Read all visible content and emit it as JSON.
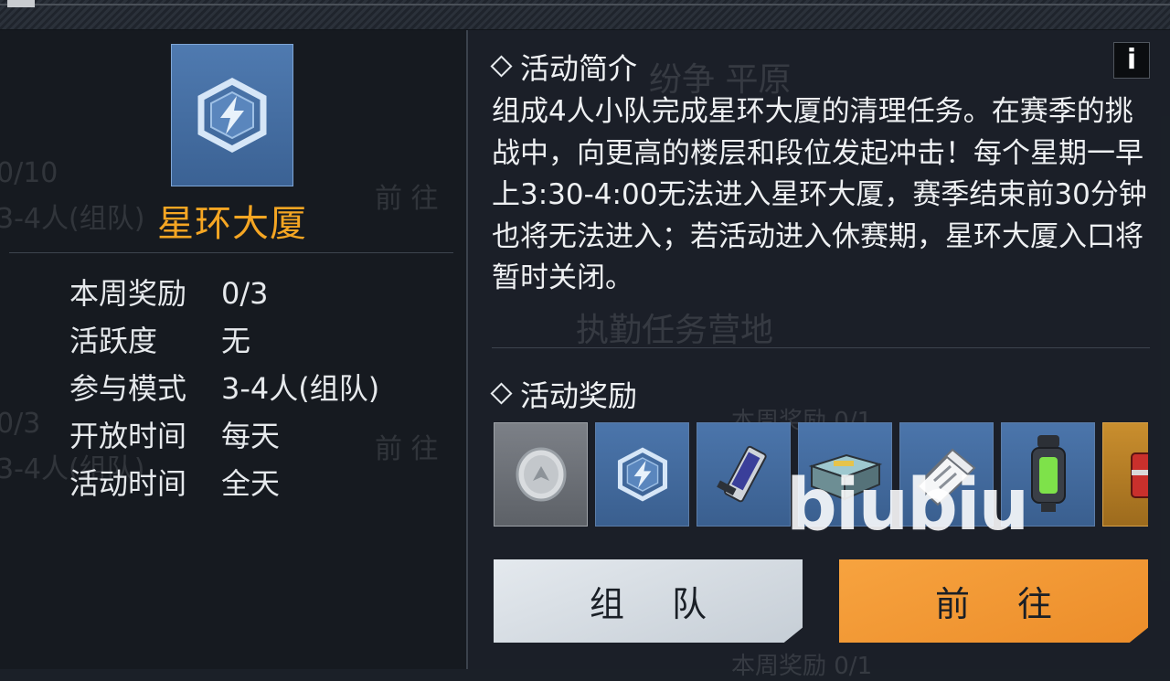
{
  "event": {
    "name": "星环大厦",
    "icon": "lightning-hexagon-icon",
    "info": [
      {
        "key": "本周奖励",
        "value": "0/3"
      },
      {
        "key": "活跃度",
        "value": "无"
      },
      {
        "key": "参与模式",
        "value": "3-4人(组队)"
      },
      {
        "key": "开放时间",
        "value": "每天"
      },
      {
        "key": "活动时间",
        "value": "全天"
      }
    ]
  },
  "intro": {
    "title": "活动简介",
    "info_button": "i",
    "description": "组成4人小队完成星环大厦的清理任务。在赛季的挑战中，向更高的楼层和段位发起冲击！每个星期一早上3:30-4:00无法进入星环大厦，赛季结束前30分钟也将无法进入；若活动进入休赛期，星环大厦入口将暂时关闭。"
  },
  "rewards": {
    "title": "活动奖励",
    "items": [
      {
        "icon": "silver-coin-icon",
        "rarity": "grey"
      },
      {
        "icon": "lightning-hexagon-icon",
        "rarity": "blue"
      },
      {
        "icon": "memory-chip-icon",
        "rarity": "blue"
      },
      {
        "icon": "supply-crate-icon",
        "rarity": "blue"
      },
      {
        "icon": "document-stack-icon",
        "rarity": "blue"
      },
      {
        "icon": "energy-canister-icon",
        "rarity": "blue"
      },
      {
        "icon": "red-chest-icon",
        "rarity": "gold"
      }
    ]
  },
  "buttons": {
    "team": "组 队",
    "go": "前 往"
  },
  "watermark": "biubiu",
  "background_texts": {
    "t1": "0/10",
    "t2": "3-4人(组队)",
    "t3": "前 往",
    "t4": "纷争 平原",
    "t5": "执勤任务营地",
    "t6": "0/3",
    "t7": "3-4人(组队)",
    "t8": "前 往",
    "t9": "本周奖励 0/1",
    "t10": "本周奖励 0/1"
  },
  "colors": {
    "title_orange": "#f5a623",
    "go_button": "#f29a36",
    "icon_blue": "#4a74a8"
  }
}
